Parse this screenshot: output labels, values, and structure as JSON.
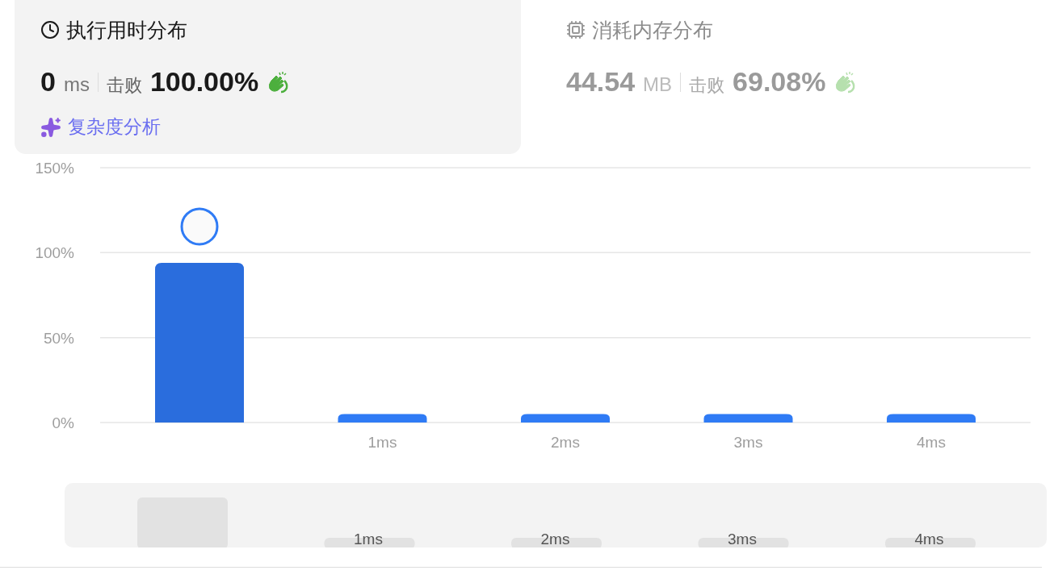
{
  "panels": [
    {
      "kind": "time",
      "title": "执行用时分布",
      "value": "0",
      "unit": "ms",
      "beats_label": "击败",
      "beats": "100.00%",
      "selected": true,
      "link": "复杂度分析"
    },
    {
      "kind": "memory",
      "title": "消耗内存分布",
      "value": "44.54",
      "unit": "MB",
      "beats_label": "击败",
      "beats": "69.08%",
      "selected": false
    }
  ],
  "chart": {
    "chart_data": {
      "type": "bar",
      "categories": [
        null,
        "1ms",
        "2ms",
        "3ms",
        "4ms"
      ],
      "values": [
        94,
        5,
        5,
        5,
        5
      ],
      "ylim": [
        0,
        150
      ],
      "yticks": [
        {
          "value": 0,
          "label": "0%"
        },
        {
          "value": 50,
          "label": "50%"
        },
        {
          "value": 100,
          "label": "100%"
        },
        {
          "value": 150,
          "label": "150%"
        }
      ]
    },
    "bars": [
      {
        "avatar": true
      },
      {
        "avatar": false
      },
      {
        "avatar": false
      },
      {
        "avatar": false
      },
      {
        "avatar": false
      }
    ]
  },
  "navigator": {
    "labels": [
      "1ms",
      "2ms",
      "3ms",
      "4ms"
    ]
  }
}
